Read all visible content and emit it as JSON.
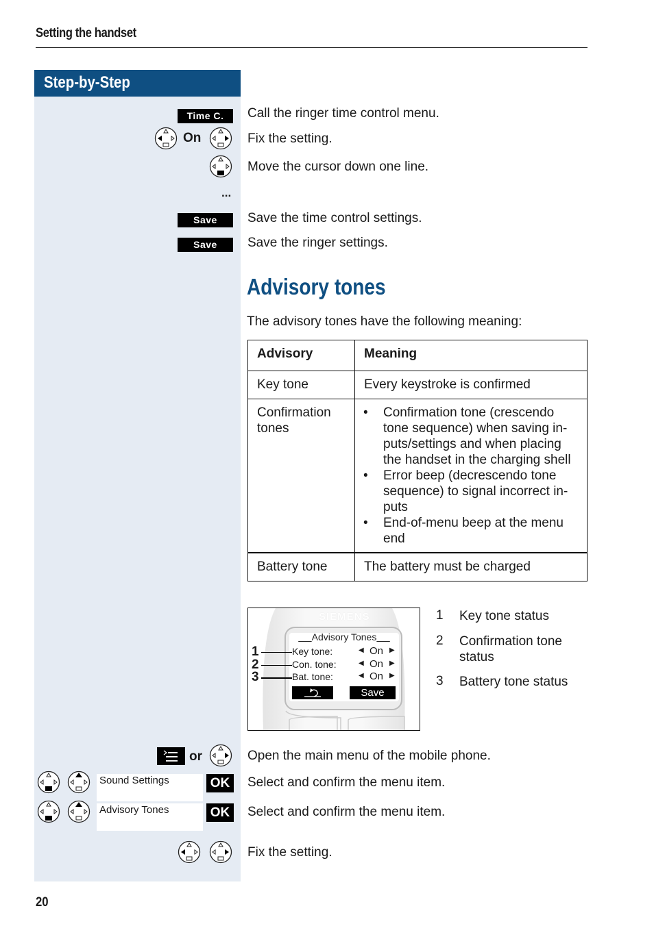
{
  "header": {
    "running_head": "Setting the handset"
  },
  "sidebar": {
    "title": "Step-by-Step"
  },
  "steps": [
    {
      "key": "Time C.",
      "desc": "Call the ringer time control menu."
    },
    {
      "key_text": "On",
      "desc": "Fix the setting."
    },
    {
      "desc": "Move the cursor down one line."
    },
    {
      "key_text": "...",
      "desc": ""
    },
    {
      "key": "Save",
      "desc": "Save the time control settings."
    },
    {
      "key": "Save",
      "desc": "Save the ringer settings."
    }
  ],
  "section": {
    "title": "Advisory tones",
    "intro": "The advisory tones have the following meaning:"
  },
  "table": {
    "headers": [
      "Advisory",
      "Meaning"
    ],
    "rows": [
      {
        "advisory": "Key tone",
        "meaning": "Every keystroke is confirmed"
      },
      {
        "advisory": "Confirmation tones",
        "bullets": [
          "Confirmation tone (crescendo tone sequence) when saving in-puts/settings and when placing the handset in the charging shell",
          "Error beep (decrescendo tone sequence) to signal incorrect in-puts",
          "End-of-menu beep at the menu end"
        ]
      },
      {
        "advisory": "Battery tone",
        "meaning": "The battery must be charged"
      }
    ]
  },
  "phone_display": {
    "brand": "SIEMENS",
    "title": "Advisory Tones",
    "rows": [
      {
        "label": "Key tone:",
        "value": "On",
        "callout": "1"
      },
      {
        "label": "Con. tone:",
        "value": "On",
        "callout": "2"
      },
      {
        "label": "Bat. tone:",
        "value": "On",
        "callout": "3"
      }
    ],
    "left_softkey": "back-arrow",
    "right_softkey": "Save"
  },
  "legend": [
    {
      "num": "1",
      "text": "Key tone status"
    },
    {
      "num": "2",
      "text": "Confirmation tone status"
    },
    {
      "num": "3",
      "text": "Battery tone status"
    }
  ],
  "steps2": [
    {
      "connector": "or",
      "desc": "Open the main menu of the mobile phone."
    },
    {
      "menu_item": "Sound Settings",
      "key": "OK",
      "desc": "Select and confirm the menu item."
    },
    {
      "menu_item": "Advisory Tones",
      "key": "OK",
      "desc": "Select and confirm the menu item."
    },
    {
      "desc": "Fix the setting."
    }
  ],
  "footer": {
    "page_number": "20"
  }
}
